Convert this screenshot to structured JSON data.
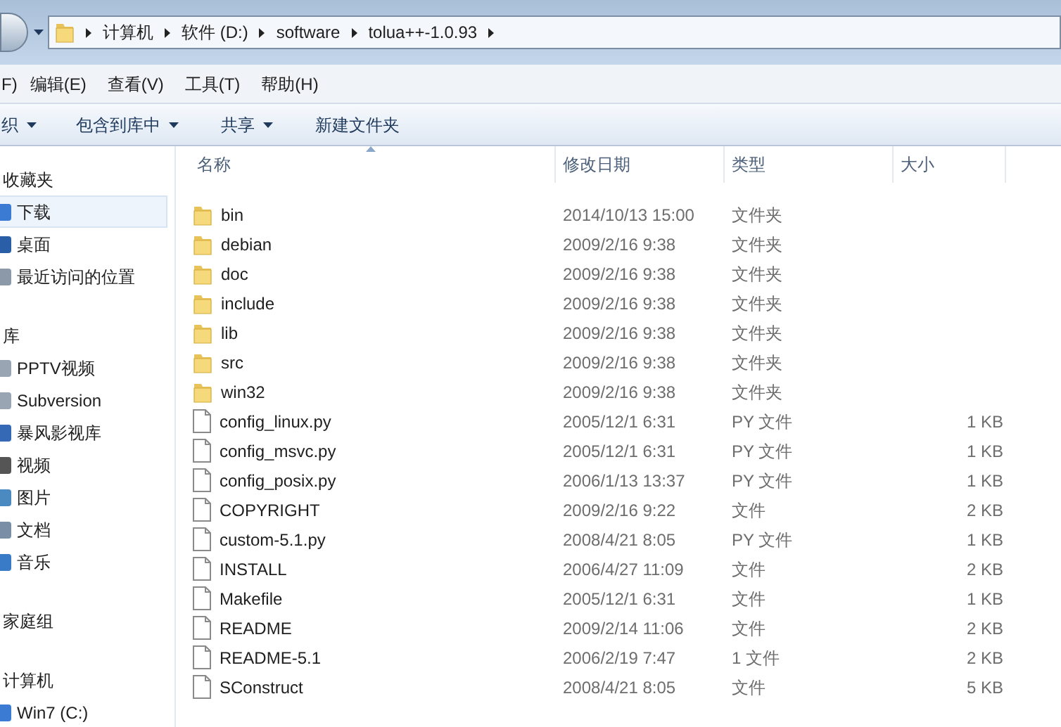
{
  "address_bar": {
    "segments": [
      "计算机",
      "软件 (D:)",
      "software",
      "tolua++-1.0.93"
    ]
  },
  "menu": [
    "F)",
    "编辑(E)",
    "查看(V)",
    "工具(T)",
    "帮助(H)"
  ],
  "toolbar": [
    {
      "label": "织",
      "dropdown": true
    },
    {
      "label": "包含到库中",
      "dropdown": true
    },
    {
      "label": "共享",
      "dropdown": true
    },
    {
      "label": "新建文件夹",
      "dropdown": false
    }
  ],
  "sidebar": {
    "groups": [
      {
        "title": "收藏夹",
        "items": [
          {
            "label": "下载",
            "selected": true
          },
          {
            "label": "桌面",
            "selected": false
          },
          {
            "label": "最近访问的位置",
            "selected": false
          }
        ]
      },
      {
        "title": "库",
        "items": [
          {
            "label": "PPTV视频",
            "selected": false
          },
          {
            "label": "Subversion",
            "selected": false
          },
          {
            "label": "暴风影视库",
            "selected": false
          },
          {
            "label": "视频",
            "selected": false
          },
          {
            "label": "图片",
            "selected": false
          },
          {
            "label": "文档",
            "selected": false
          },
          {
            "label": "音乐",
            "selected": false
          }
        ]
      },
      {
        "title": "家庭组"
      },
      {
        "title": "计算机",
        "items": [
          {
            "label": "Win7 (C:)",
            "selected": false
          }
        ]
      }
    ]
  },
  "table": {
    "columns": [
      "名称",
      "修改日期",
      "类型",
      "大小"
    ],
    "rows": [
      {
        "kind": "folder",
        "name": "bin",
        "date": "2014/10/13 15:00",
        "type": "文件夹"
      },
      {
        "kind": "folder",
        "name": "debian",
        "date": "2009/2/16 9:38",
        "type": "文件夹"
      },
      {
        "kind": "folder",
        "name": "doc",
        "date": "2009/2/16 9:38",
        "type": "文件夹"
      },
      {
        "kind": "folder",
        "name": "include",
        "date": "2009/2/16 9:38",
        "type": "文件夹"
      },
      {
        "kind": "folder",
        "name": "lib",
        "date": "2009/2/16 9:38",
        "type": "文件夹"
      },
      {
        "kind": "folder",
        "name": "src",
        "date": "2009/2/16 9:38",
        "type": "文件夹"
      },
      {
        "kind": "folder",
        "name": "win32",
        "date": "2009/2/16 9:38",
        "type": "文件夹"
      },
      {
        "kind": "file",
        "name": "config_linux.py",
        "date": "2005/12/1 6:31",
        "type": "PY 文件",
        "size": "1 KB"
      },
      {
        "kind": "file",
        "name": "config_msvc.py",
        "date": "2005/12/1 6:31",
        "type": "PY 文件",
        "size": "1 KB"
      },
      {
        "kind": "file",
        "name": "config_posix.py",
        "date": "2006/1/13 13:37",
        "type": "PY 文件",
        "size": "1 KB"
      },
      {
        "kind": "file",
        "name": "COPYRIGHT",
        "date": "2009/2/16 9:22",
        "type": "文件",
        "size": "2 KB"
      },
      {
        "kind": "file",
        "name": "custom-5.1.py",
        "date": "2008/4/21 8:05",
        "type": "PY 文件",
        "size": "1 KB"
      },
      {
        "kind": "file",
        "name": "INSTALL",
        "date": "2006/4/27 11:09",
        "type": "文件",
        "size": "2 KB"
      },
      {
        "kind": "file",
        "name": "Makefile",
        "date": "2005/12/1 6:31",
        "type": "文件",
        "size": "1 KB"
      },
      {
        "kind": "file",
        "name": "README",
        "date": "2009/2/14 11:06",
        "type": "文件",
        "size": "2 KB"
      },
      {
        "kind": "file",
        "name": "README-5.1",
        "date": "2006/2/19 7:47",
        "type": "1 文件",
        "size": "2 KB"
      },
      {
        "kind": "file",
        "name": "SConstruct",
        "date": "2008/4/21 8:05",
        "type": "文件",
        "size": "5 KB"
      }
    ]
  }
}
